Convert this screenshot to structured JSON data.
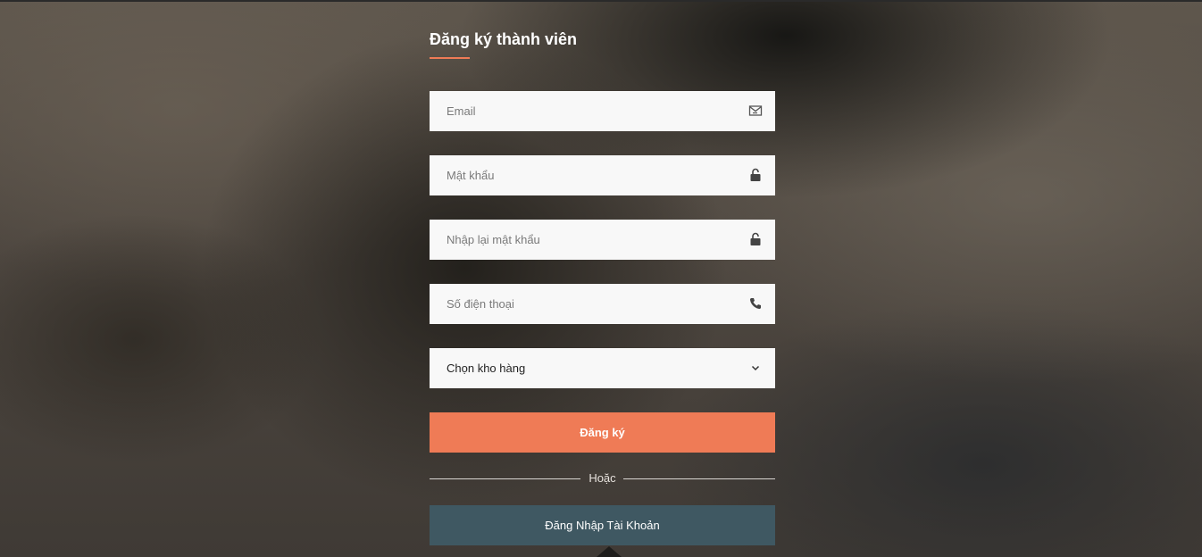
{
  "form": {
    "title": "Đăng ký thành viên",
    "email": {
      "placeholder": "Email",
      "icon": "mail-icon"
    },
    "password": {
      "placeholder": "Mật khẩu",
      "icon": "unlock-icon"
    },
    "confirm_password": {
      "placeholder": "Nhập lại mật khẩu",
      "icon": "unlock-icon"
    },
    "phone": {
      "placeholder": "Số điện thoại",
      "icon": "phone-icon"
    },
    "warehouse": {
      "selected": "Chọn kho hàng",
      "icon": "chevron-down-icon"
    },
    "register_label": "Đăng ký",
    "or_label": "Hoặc",
    "login_label": "Đăng Nhập Tài Khoản"
  },
  "colors": {
    "accent": "#ef7b56",
    "login_button": "#3f5862",
    "field_bg": "#f8f8f8"
  }
}
